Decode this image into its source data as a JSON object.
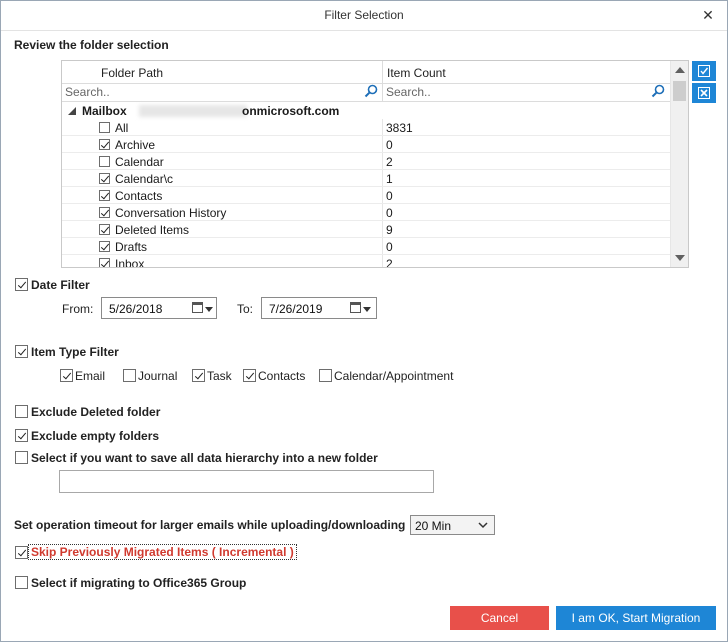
{
  "window": {
    "title": "Filter Selection",
    "close_glyph": "✕"
  },
  "folder_section": {
    "title": "Review the folder selection",
    "columns": {
      "path": "Folder Path",
      "count": "Item Count"
    },
    "search": {
      "path_placeholder": "Search..",
      "count_placeholder": "Search.."
    },
    "mailbox": {
      "prefix": "Mailbox",
      "suffix": "onmicrosoft.com"
    },
    "rows": [
      {
        "name": "All",
        "count": "3831",
        "checked": false
      },
      {
        "name": "Archive",
        "count": "0",
        "checked": true
      },
      {
        "name": "Calendar",
        "count": "2",
        "checked": false
      },
      {
        "name": "Calendar\\c",
        "count": "1",
        "checked": true
      },
      {
        "name": "Contacts",
        "count": "0",
        "checked": true
      },
      {
        "name": "Conversation History",
        "count": "0",
        "checked": true
      },
      {
        "name": "Deleted Items",
        "count": "9",
        "checked": true
      },
      {
        "name": "Drafts",
        "count": "0",
        "checked": true
      },
      {
        "name": "Inbox",
        "count": "2",
        "checked": true
      }
    ]
  },
  "date_filter": {
    "label": "Date Filter",
    "checked": true,
    "from_label": "From:",
    "from_value": "5/26/2018",
    "to_label": "To:",
    "to_value": "7/26/2019"
  },
  "item_type_filter": {
    "label": "Item Type Filter",
    "checked": true,
    "types": [
      {
        "label": "Email",
        "checked": true
      },
      {
        "label": "Journal",
        "checked": false
      },
      {
        "label": "Task",
        "checked": true
      },
      {
        "label": "Contacts",
        "checked": true
      },
      {
        "label": "Calendar/Appointment",
        "checked": false
      }
    ]
  },
  "options": {
    "exclude_deleted": {
      "label": "Exclude Deleted folder",
      "checked": false
    },
    "exclude_empty": {
      "label": "Exclude empty folders",
      "checked": true
    },
    "save_hierarchy": {
      "label": "Select if you want to save all data hierarchy into a new folder",
      "checked": false,
      "folder_name": ""
    }
  },
  "timeout": {
    "label": "Set operation timeout for larger emails while uploading/downloading",
    "value": "20 Min"
  },
  "incremental": {
    "label": "Skip Previously Migrated Items ( Incremental )",
    "checked": true
  },
  "office365_group": {
    "label": "Select if migrating to Office365 Group",
    "checked": false
  },
  "buttons": {
    "cancel": "Cancel",
    "start": "I am OK, Start Migration"
  },
  "colors": {
    "cancel_bg": "#e8504a",
    "start_bg": "#1e86d6",
    "accent": "#1e86d6",
    "incremental_text": "#d03a2f"
  }
}
